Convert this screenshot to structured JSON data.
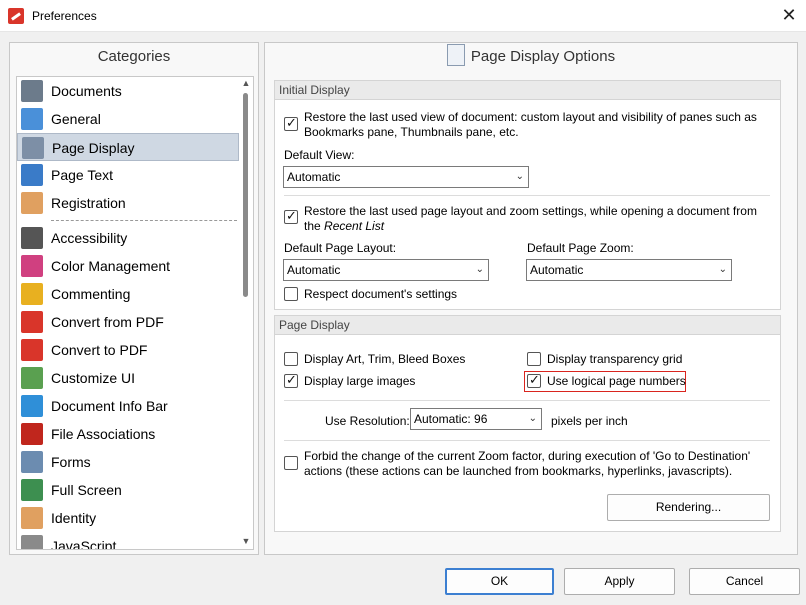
{
  "window": {
    "title": "Preferences"
  },
  "categories": {
    "header": "Categories",
    "items": [
      {
        "label": "Documents",
        "icon": "documents-icon",
        "color": "#6c7b8b"
      },
      {
        "label": "General",
        "icon": "general-settings-icon",
        "color": "#4a90d9"
      },
      {
        "label": "Page Display",
        "icon": "page-display-icon",
        "color": "#7d8fa6"
      },
      {
        "label": "Page Text",
        "icon": "page-text-icon",
        "color": "#3a7bc8"
      },
      {
        "label": "Registration",
        "icon": "registration-user-icon",
        "color": "#e0a060"
      },
      {
        "label": "Accessibility",
        "icon": "accessibility-glasses-icon",
        "color": "#555555"
      },
      {
        "label": "Color Management",
        "icon": "color-wheel-icon",
        "color": "#d04080"
      },
      {
        "label": "Commenting",
        "icon": "commenting-icon",
        "color": "#e8b020"
      },
      {
        "label": "Convert from PDF",
        "icon": "convert-from-pdf-icon",
        "color": "#d9352a"
      },
      {
        "label": "Convert to PDF",
        "icon": "convert-to-pdf-icon",
        "color": "#d9352a"
      },
      {
        "label": "Customize UI",
        "icon": "customize-ui-icon",
        "color": "#5aa050"
      },
      {
        "label": "Document Info Bar",
        "icon": "info-icon",
        "color": "#2f8fd8"
      },
      {
        "label": "File Associations",
        "icon": "pdf-file-icon",
        "color": "#c0261d"
      },
      {
        "label": "Forms",
        "icon": "forms-icon",
        "color": "#6c8cb0"
      },
      {
        "label": "Full Screen",
        "icon": "full-screen-icon",
        "color": "#3d8f50"
      },
      {
        "label": "Identity",
        "icon": "identity-icon",
        "color": "#e0a060"
      },
      {
        "label": "JavaScript",
        "icon": "javascript-icon",
        "color": "#8a8a8a"
      }
    ],
    "selected": "Page Display"
  },
  "main": {
    "header": "Page Display Options",
    "initial_display": {
      "title": "Initial Display",
      "restore_view_line1": "Restore the last used view of document: custom layout and visibility of panes such as",
      "restore_view_line2": "Bookmarks pane, Thumbnails pane, etc.",
      "default_view_label": "Default View:",
      "default_view_value": "Automatic",
      "restore_layout_line1": "Restore the last used page layout and zoom settings, while opening a document from",
      "restore_layout_line2_prefix": "the",
      "restore_layout_line2_italic": "Recent List",
      "default_page_layout_label": "Default Page Layout:",
      "default_page_layout_value": "Automatic",
      "default_page_zoom_label": "Default Page Zoom:",
      "default_page_zoom_value": "Automatic",
      "respect_settings": "Respect document's settings"
    },
    "page_display": {
      "title": "Page Display",
      "display_art": "Display Art, Trim, Bleed Boxes",
      "display_transparency": "Display transparency grid",
      "display_large_images": "Display large images",
      "logical_page_numbers": "Use logical page numbers",
      "use_resolution_label": "Use Resolution:",
      "resolution_value": "Automatic: 96",
      "resolution_unit": "pixels per inch",
      "forbid_zoom_line1": "Forbid the change of the current Zoom factor, during execution of 'Go to Destination'",
      "forbid_zoom_line2": "actions (these actions can be launched from bookmarks, hyperlinks, javascripts).",
      "rendering_button": "Rendering..."
    }
  },
  "footer": {
    "ok": "OK",
    "apply": "Apply",
    "cancel": "Cancel"
  }
}
